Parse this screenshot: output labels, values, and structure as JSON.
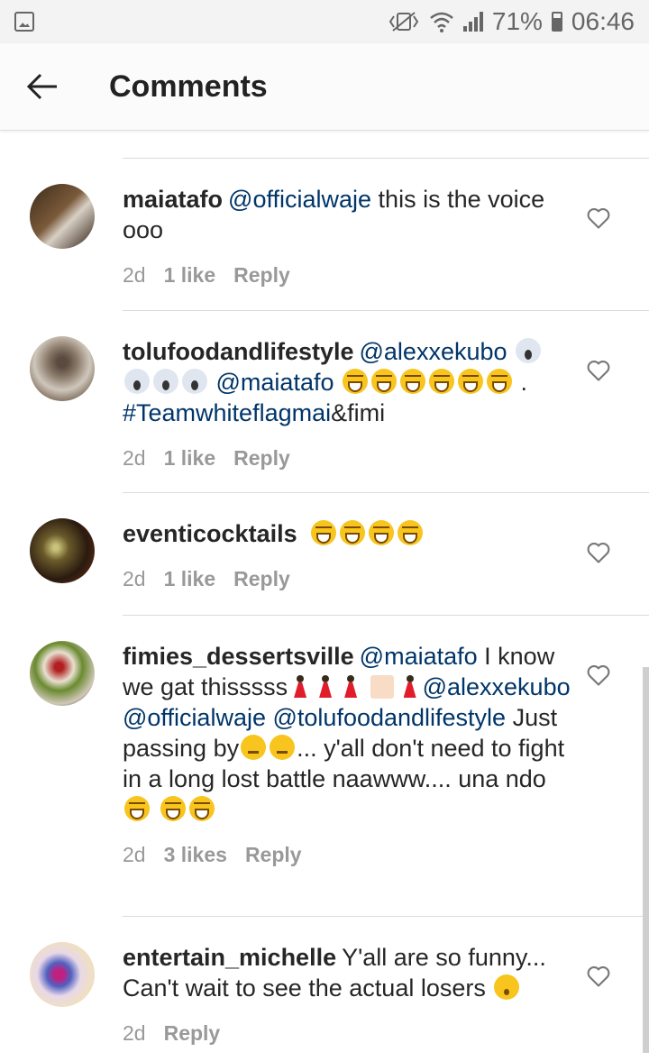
{
  "status_bar": {
    "battery": "71%",
    "time": "06:46",
    "icons": [
      "gallery-icon",
      "vibrate-icon",
      "wifi-icon",
      "signal-icon",
      "battery-icon"
    ]
  },
  "header": {
    "title": "Comments",
    "back_icon": "arrow-left-icon"
  },
  "comments": [
    {
      "username": "maiatafo",
      "mention1": "@officialwaje",
      "text": "this is the voice ooo",
      "time": "2d",
      "likes": "1 like",
      "reply": "Reply"
    },
    {
      "username": "tolufoodandlifestyle",
      "mention1": "@alexxekubo",
      "mention2": "@maiatafo",
      "tail": ".",
      "hashtag": "#Teamwhiteflagmai",
      "text_after": "&fimi",
      "time": "2d",
      "likes": "1 like",
      "reply": "Reply"
    },
    {
      "username": "eventicocktails",
      "time": "2d",
      "likes": "1 like",
      "reply": "Reply"
    },
    {
      "username": "fimies_dessertsville",
      "mention1": "@maiatafo",
      "text1": "I know we gat thisssss",
      "mention2": "@alexxekubo",
      "mention3": "@officialwaje",
      "mention4": "@tolufoodandlifestyle",
      "text2": "Just passing by",
      "text3": "... y'all don't need to fight in a long lost battle naawww.... una ndo",
      "time": "2d",
      "likes": "3 likes",
      "reply": "Reply"
    },
    {
      "username": "entertain_michelle",
      "text": "Y'all are so funny... Can't wait to see the actual losers",
      "time": "2d",
      "reply": "Reply"
    }
  ],
  "colors": {
    "mention": "#003569",
    "meta": "#999999",
    "divider": "#dbdbdb"
  }
}
